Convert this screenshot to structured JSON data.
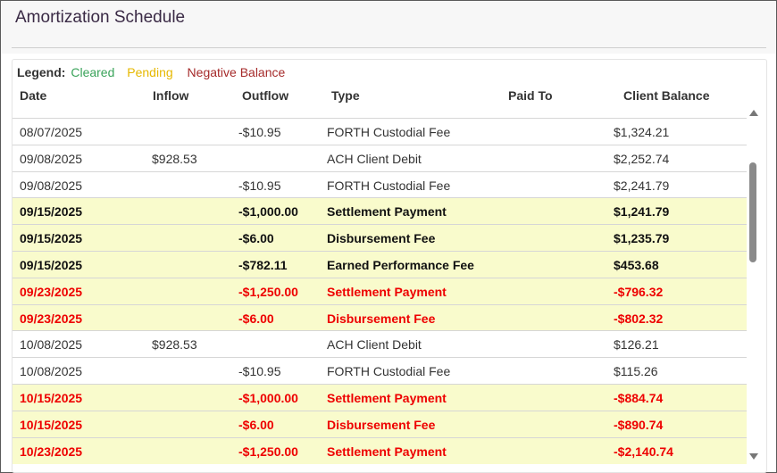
{
  "title": "Amortization Schedule",
  "legend": {
    "label": "Legend:",
    "cleared": "Cleared",
    "pending": "Pending",
    "negative": "Negative Balance"
  },
  "colors": {
    "cleared": "#3aa35a",
    "pending": "#e6b800",
    "negative_legend": "#a52a2a",
    "negative_row": "#ee0000",
    "highlight_bg": "#f9fbcc"
  },
  "columns": {
    "date": "Date",
    "inflow": "Inflow",
    "outflow": "Outflow",
    "type": "Type",
    "paid_to": "Paid To",
    "client_balance": "Client Balance"
  },
  "rows": [
    {
      "status": "cleared",
      "date": "08/07/2025",
      "inflow": "",
      "outflow": "-$10.95",
      "type": "FORTH Custodial Fee",
      "paid_to": "",
      "balance": "$1,324.21"
    },
    {
      "status": "cleared",
      "date": "09/08/2025",
      "inflow": "$928.53",
      "outflow": "",
      "type": "ACH Client Debit",
      "paid_to": "",
      "balance": "$2,252.74"
    },
    {
      "status": "cleared",
      "date": "09/08/2025",
      "inflow": "",
      "outflow": "-$10.95",
      "type": "FORTH Custodial Fee",
      "paid_to": "",
      "balance": "$2,241.79"
    },
    {
      "status": "pending",
      "date": "09/15/2025",
      "inflow": "",
      "outflow": "-$1,000.00",
      "type": "Settlement Payment",
      "paid_to": "",
      "balance": "$1,241.79"
    },
    {
      "status": "pending",
      "date": "09/15/2025",
      "inflow": "",
      "outflow": "-$6.00",
      "type": "Disbursement Fee",
      "paid_to": "",
      "balance": "$1,235.79"
    },
    {
      "status": "pending",
      "date": "09/15/2025",
      "inflow": "",
      "outflow": "-$782.11",
      "type": "Earned Performance Fee",
      "paid_to": "",
      "balance": "$453.68"
    },
    {
      "status": "negative",
      "date": "09/23/2025",
      "inflow": "",
      "outflow": "-$1,250.00",
      "type": "Settlement Payment",
      "paid_to": "",
      "balance": "-$796.32"
    },
    {
      "status": "negative",
      "date": "09/23/2025",
      "inflow": "",
      "outflow": "-$6.00",
      "type": "Disbursement Fee",
      "paid_to": "",
      "balance": "-$802.32"
    },
    {
      "status": "cleared",
      "date": "10/08/2025",
      "inflow": "$928.53",
      "outflow": "",
      "type": "ACH Client Debit",
      "paid_to": "",
      "balance": "$126.21"
    },
    {
      "status": "cleared",
      "date": "10/08/2025",
      "inflow": "",
      "outflow": "-$10.95",
      "type": "FORTH Custodial Fee",
      "paid_to": "",
      "balance": "$115.26"
    },
    {
      "status": "negative",
      "date": "10/15/2025",
      "inflow": "",
      "outflow": "-$1,000.00",
      "type": "Settlement Payment",
      "paid_to": "",
      "balance": "-$884.74"
    },
    {
      "status": "negative",
      "date": "10/15/2025",
      "inflow": "",
      "outflow": "-$6.00",
      "type": "Disbursement Fee",
      "paid_to": "",
      "balance": "-$890.74"
    },
    {
      "status": "negative",
      "date": "10/23/2025",
      "inflow": "",
      "outflow": "-$1,250.00",
      "type": "Settlement Payment",
      "paid_to": "",
      "balance": "-$2,140.74"
    }
  ],
  "scrollbar": {
    "up_icon": "arrow-up-icon",
    "down_icon": "arrow-down-icon"
  }
}
